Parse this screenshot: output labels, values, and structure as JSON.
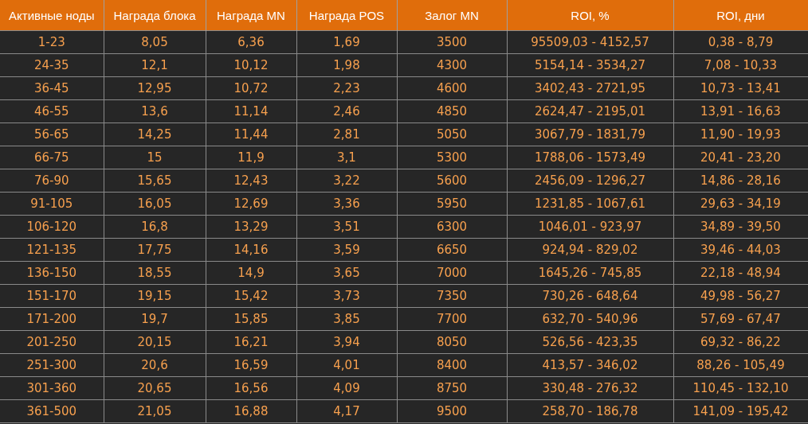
{
  "table": {
    "columns": [
      "Активные ноды",
      "Награда блока",
      "Награда MN",
      "Награда POS",
      "Залог MN",
      "ROI, %",
      "ROI, дни"
    ],
    "rows": [
      [
        "1-23",
        "8,05",
        "6,36",
        "1,69",
        "3500",
        "95509,03 - 4152,57",
        "0,38 - 8,79"
      ],
      [
        "24-35",
        "12,1",
        "10,12",
        "1,98",
        "4300",
        "5154,14 - 3534,27",
        "7,08 - 10,33"
      ],
      [
        "36-45",
        "12,95",
        "10,72",
        "2,23",
        "4600",
        "3402,43 - 2721,95",
        "10,73 - 13,41"
      ],
      [
        "46-55",
        "13,6",
        "11,14",
        "2,46",
        "4850",
        "2624,47 - 2195,01",
        "13,91 - 16,63"
      ],
      [
        "56-65",
        "14,25",
        "11,44",
        "2,81",
        "5050",
        "3067,79 - 1831,79",
        "11,90 - 19,93"
      ],
      [
        "66-75",
        "15",
        "11,9",
        "3,1",
        "5300",
        "1788,06 - 1573,49",
        "20,41 - 23,20"
      ],
      [
        "76-90",
        "15,65",
        "12,43",
        "3,22",
        "5600",
        "2456,09 - 1296,27",
        "14,86 - 28,16"
      ],
      [
        "91-105",
        "16,05",
        "12,69",
        "3,36",
        "5950",
        "1231,85 - 1067,61",
        "29,63 - 34,19"
      ],
      [
        "106-120",
        "16,8",
        "13,29",
        "3,51",
        "6300",
        "1046,01 - 923,97",
        "34,89 - 39,50"
      ],
      [
        "121-135",
        "17,75",
        "14,16",
        "3,59",
        "6650",
        "924,94 - 829,02",
        "39,46 - 44,03"
      ],
      [
        "136-150",
        "18,55",
        "14,9",
        "3,65",
        "7000",
        "1645,26 - 745,85",
        "22,18 - 48,94"
      ],
      [
        "151-170",
        "19,15",
        "15,42",
        "3,73",
        "7350",
        "730,26 - 648,64",
        "49,98 - 56,27"
      ],
      [
        "171-200",
        "19,7",
        "15,85",
        "3,85",
        "7700",
        "632,70 - 540,96",
        "57,69 - 67,47"
      ],
      [
        "201-250",
        "20,15",
        "16,21",
        "3,94",
        "8050",
        "526,56 - 423,35",
        "69,32 - 86,22"
      ],
      [
        "251-300",
        "20,6",
        "16,59",
        "4,01",
        "8400",
        "413,57 - 346,02",
        "88,26 - 105,49"
      ],
      [
        "301-360",
        "20,65",
        "16,56",
        "4,09",
        "8750",
        "330,48 - 276,32",
        "110,45 - 132,10"
      ],
      [
        "361-500",
        "21,05",
        "16,88",
        "4,17",
        "9500",
        "258,70 - 186,78",
        "141,09 - 195,42"
      ]
    ]
  }
}
